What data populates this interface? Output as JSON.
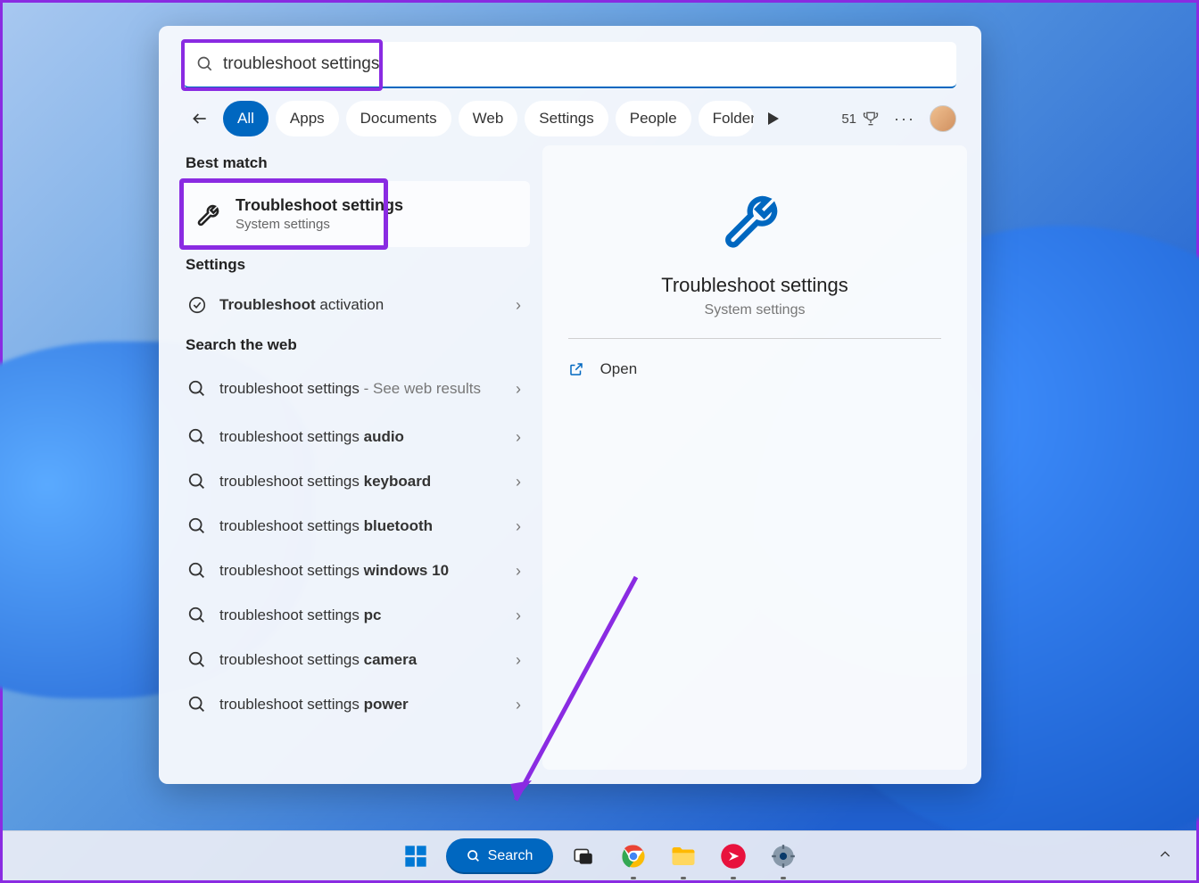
{
  "search": {
    "value": "troubleshoot settings"
  },
  "tabs": [
    "All",
    "Apps",
    "Documents",
    "Web",
    "Settings",
    "People",
    "Folders"
  ],
  "active_tab": 0,
  "rewards_points": "51",
  "sections": {
    "best_match": "Best match",
    "settings": "Settings",
    "search_web": "Search the web"
  },
  "best": {
    "title": "Troubleshoot settings",
    "subtitle": "System settings"
  },
  "settings_items": [
    {
      "prefix": "Troubleshoot",
      "rest": " activation",
      "bold_first": true
    }
  ],
  "web_items": [
    {
      "prefix": "troubleshoot settings",
      "suffix": " - See web results"
    },
    {
      "prefix": "troubleshoot settings ",
      "bold": "audio"
    },
    {
      "prefix": "troubleshoot settings ",
      "bold": "keyboard"
    },
    {
      "prefix": "troubleshoot settings ",
      "bold": "bluetooth"
    },
    {
      "prefix": "troubleshoot settings ",
      "bold": "windows 10"
    },
    {
      "prefix": "troubleshoot settings ",
      "bold": "pc"
    },
    {
      "prefix": "troubleshoot settings ",
      "bold": "camera"
    },
    {
      "prefix": "troubleshoot settings ",
      "bold": "power"
    }
  ],
  "detail": {
    "title": "Troubleshoot settings",
    "subtitle": "System settings",
    "open": "Open"
  },
  "taskbar": {
    "search": "Search"
  },
  "annotation": {
    "highlight_color": "#8a2be2"
  }
}
